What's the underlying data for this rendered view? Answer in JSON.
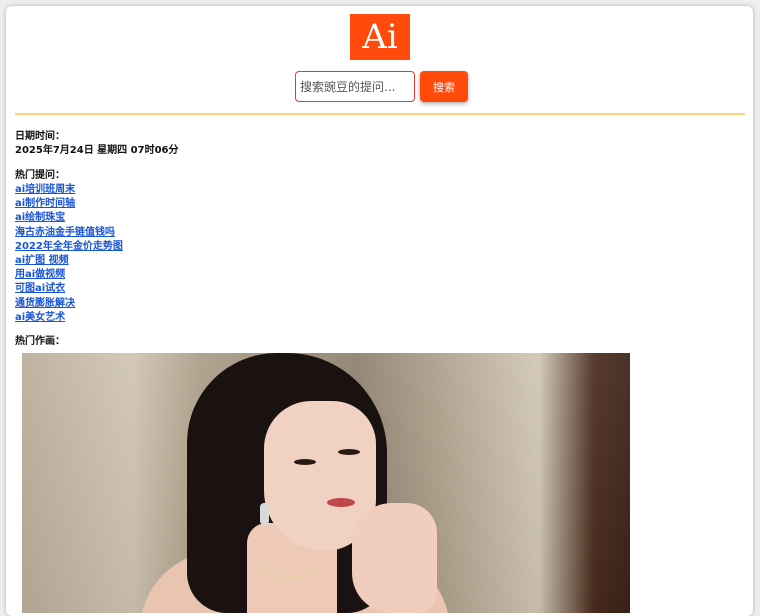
{
  "logo": {
    "text": "Ai"
  },
  "search": {
    "placeholder": "搜索豌豆的提问...",
    "button_label": "搜索"
  },
  "datetime": {
    "label": "日期时间：",
    "value": "2025年7月24日 星期四 07时06分"
  },
  "hot_questions": {
    "label": "热门提问：",
    "items": [
      "ai培训班周末",
      "ai制作时间轴",
      "ai绘制珠宝",
      "海古赤油金手链值钱吗",
      "2022年全年金价走势图",
      "ai扩图 视频",
      "用ai做视频",
      "可图ai试衣",
      "通货膨胀解决",
      "ai美女艺术"
    ]
  },
  "hot_art": {
    "label": "热门作画："
  },
  "colors": {
    "accent": "#ff4a0c",
    "link": "#1a55d6",
    "divider": "#ffd27a"
  }
}
